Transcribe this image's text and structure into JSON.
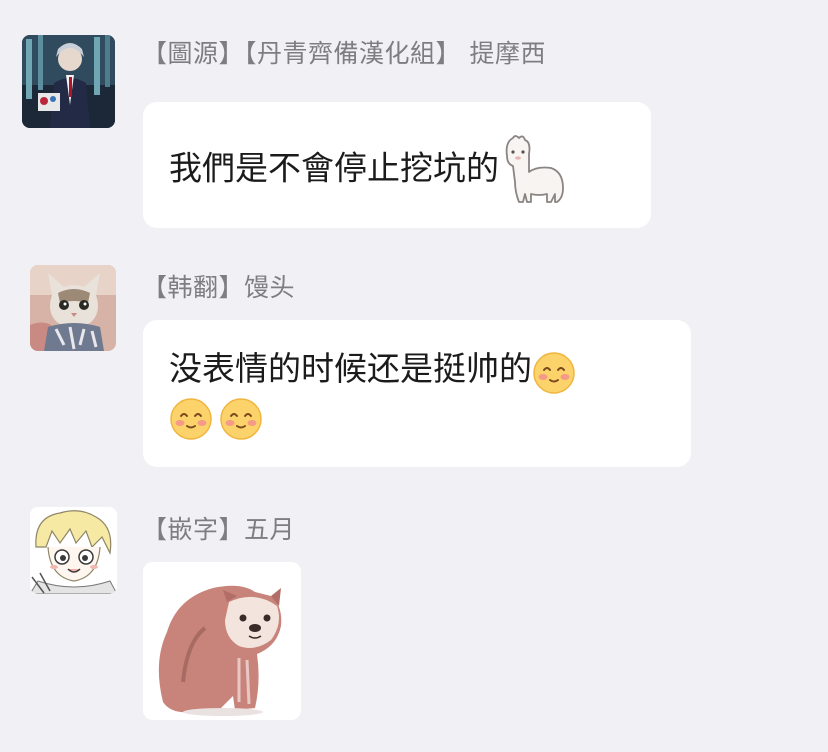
{
  "messages": [
    {
      "sender": "【圖源】【丹青齊備漢化組】 提摩西",
      "text": "我們是不會停止挖坑的",
      "trailing_sticker": "alpaca-sticker"
    },
    {
      "sender": "【韩翻】馒头",
      "text_line1": "没表情的时候还是挺帅的",
      "trailing_emoji": "blush-smile-emoji",
      "emoji_line2_count": 2
    },
    {
      "sender": "【嵌字】五月",
      "sticker": "sitting-dog-sticker"
    }
  ],
  "colors": {
    "background": "#f1f1f5",
    "bubble": "#ffffff",
    "sender_text": "#7d7d83",
    "message_text": "#1b1b1b"
  }
}
